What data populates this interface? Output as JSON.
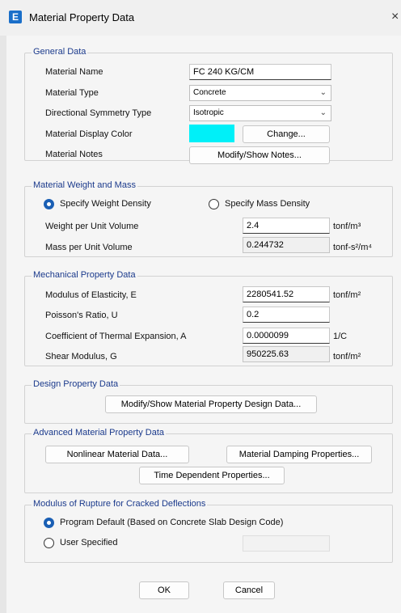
{
  "window": {
    "title": "Material Property Data",
    "app_icon": "E",
    "close": "×"
  },
  "general": {
    "legend": "General Data",
    "name_label": "Material Name",
    "name_value": "FC 240 KG/CM",
    "type_label": "Material Type",
    "type_value": "Concrete",
    "symmetry_label": "Directional Symmetry Type",
    "symmetry_value": "Isotropic",
    "color_label": "Material Display Color",
    "color": "#00f0f8",
    "change_label": "Change...",
    "notes_label": "Material Notes",
    "notes_button": "Modify/Show Notes..."
  },
  "weight": {
    "legend": "Material Weight and Mass",
    "radio_weight": "Specify Weight Density",
    "radio_mass": "Specify Mass Density",
    "weight_label": "Weight per Unit Volume",
    "weight_value": "2.4",
    "weight_unit": "tonf/m³",
    "mass_label": "Mass per Unit Volume",
    "mass_value": "0.244732",
    "mass_unit": "tonf-s²/m⁴"
  },
  "mechanical": {
    "legend": "Mechanical Property Data",
    "e_label": "Modulus of Elasticity,  E",
    "e_value": "2280541.52",
    "e_unit": "tonf/m²",
    "u_label": "Poisson's Ratio,  U",
    "u_value": "0.2",
    "a_label": "Coefficient of Thermal Expansion,  A",
    "a_value": "0.0000099",
    "a_unit": "1/C",
    "g_label": "Shear Modulus,  G",
    "g_value": "950225.63",
    "g_unit": "tonf/m²"
  },
  "design": {
    "legend": "Design Property Data",
    "button": "Modify/Show Material Property Design Data..."
  },
  "advanced": {
    "legend": "Advanced Material Property Data",
    "nonlinear": "Nonlinear Material Data...",
    "damping": "Material Damping Properties...",
    "time": "Time Dependent Properties..."
  },
  "rupture": {
    "legend": "Modulus of Rupture for Cracked Deflections",
    "radio_default": "Program Default  (Based on Concrete Slab Design Code)",
    "radio_user": "User Specified"
  },
  "footer": {
    "ok": "OK",
    "cancel": "Cancel"
  },
  "colors": {
    "accent": "#1a5fb4",
    "legend": "#1b3a8c"
  }
}
